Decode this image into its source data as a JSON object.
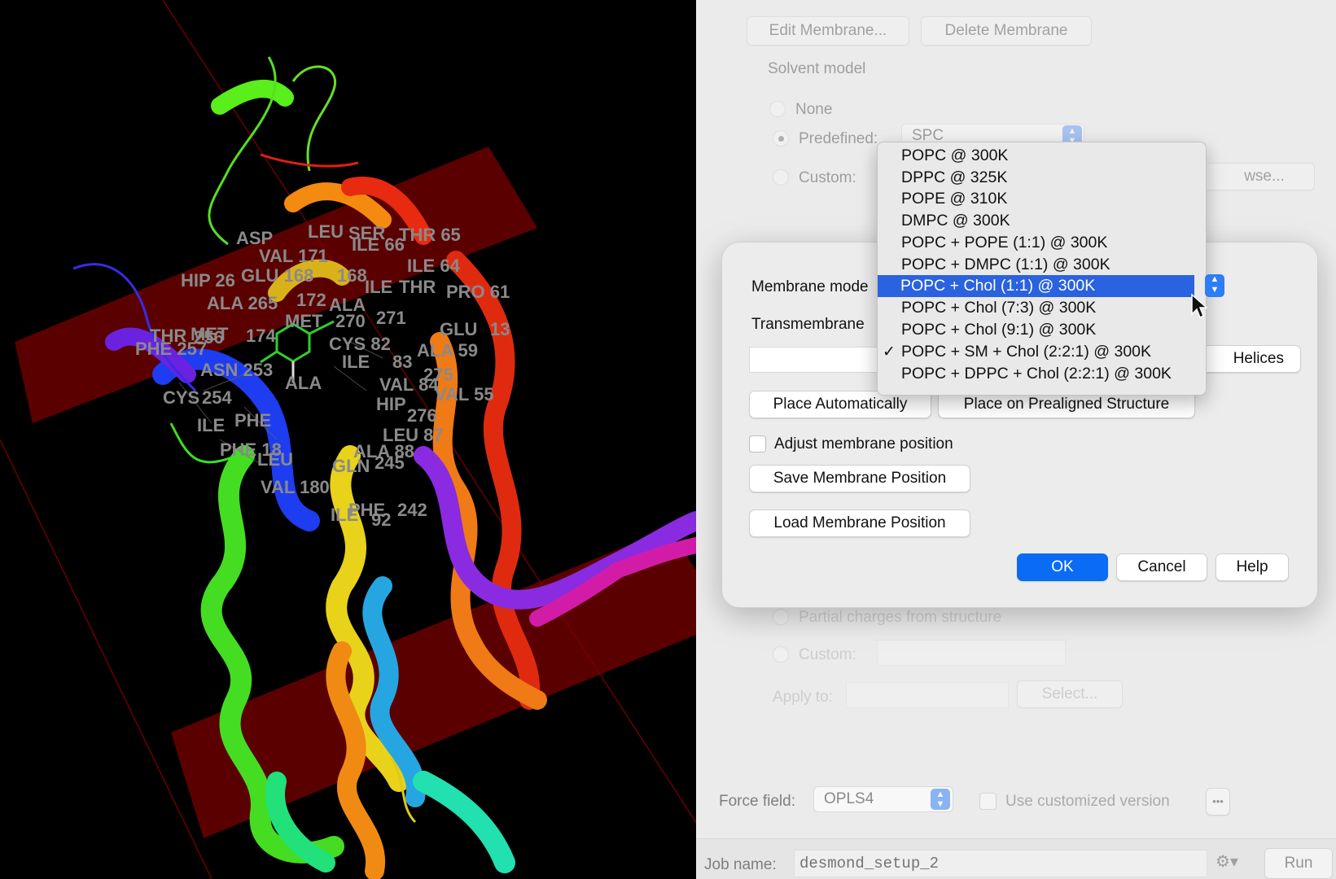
{
  "viewer": {
    "residue_labels": [
      "ASP",
      "LEU",
      "SER",
      "THR 65",
      "VAL 171",
      "ILE 66",
      "ILE 64",
      "HIP 26",
      "GLU 168",
      "168",
      "ILE",
      "THR",
      "PRO 61",
      "ALA 265",
      "172",
      "ALA",
      "MET",
      "270",
      "271",
      "GLU",
      "13",
      "THR",
      "MET",
      "256",
      "174",
      "PHE 257",
      "CYS 82",
      "ALA 59",
      "ASN 253",
      "ILE",
      "83",
      "ALA",
      "275",
      "CYS",
      "254",
      "VAL 84",
      "HIP",
      "VAL 55",
      "ILE",
      "PHE",
      "276",
      "LEU 87",
      "PHE 18",
      "LEU",
      "GLN",
      "ALA 88",
      "245",
      "VAL 180",
      "ILE",
      "PHE",
      "242",
      "92"
    ]
  },
  "panel": {
    "edit_membrane": "Edit Membrane...",
    "delete_membrane": "Delete Membrane",
    "solvent_model_label": "Solvent model",
    "none_label": "None",
    "predefined_label": "Predefined:",
    "predefined_value": "SPC",
    "custom_label": "Custom:",
    "browse_label": "wse...",
    "partial_charges_label": "Partial charges from structure",
    "custom2_label": "Custom:",
    "apply_to_label": "Apply to:",
    "select_label": "Select...",
    "force_field_label": "Force field:",
    "force_field_value": "OPLS4",
    "use_customized_label": "Use customized version",
    "more_label": "•••",
    "job_name_label": "Job name:",
    "job_name_value": "desmond_setup_2",
    "run_label": "Run"
  },
  "dialog": {
    "membrane_model_label": "Membrane mode",
    "transmembrane_label": "Transmembrane",
    "helices_label": "Helices",
    "place_auto": "Place Automatically",
    "place_prealigned": "Place on Prealigned Structure",
    "adjust_label": "Adjust membrane position",
    "save_position": "Save Membrane Position",
    "load_position": "Load Membrane Position",
    "ok": "OK",
    "cancel": "Cancel",
    "help": "Help"
  },
  "dropdown": {
    "options": [
      "POPC @ 300K",
      "DPPC @ 325K",
      "POPE @ 310K",
      "DMPC @ 300K",
      "POPC + POPE (1:1) @ 300K",
      "POPC + DMPC (1:1) @ 300K",
      "POPC + Chol (1:1) @ 300K",
      "POPC + Chol (7:3) @ 300K",
      "POPC + Chol (9:1) @ 300K",
      "POPC + SM + Chol (2:2:1) @ 300K",
      "POPC + DPPC + Chol (2:2:1) @ 300K"
    ],
    "highlighted": "POPC + Chol (1:1) @ 300K",
    "checked": "POPC + SM + Chol (2:2:1) @ 300K",
    "check_mark": "✓"
  },
  "colors": {
    "accent": "#0a6cf5",
    "highlight": "#2a62e0",
    "membrane": "#7a0000"
  }
}
